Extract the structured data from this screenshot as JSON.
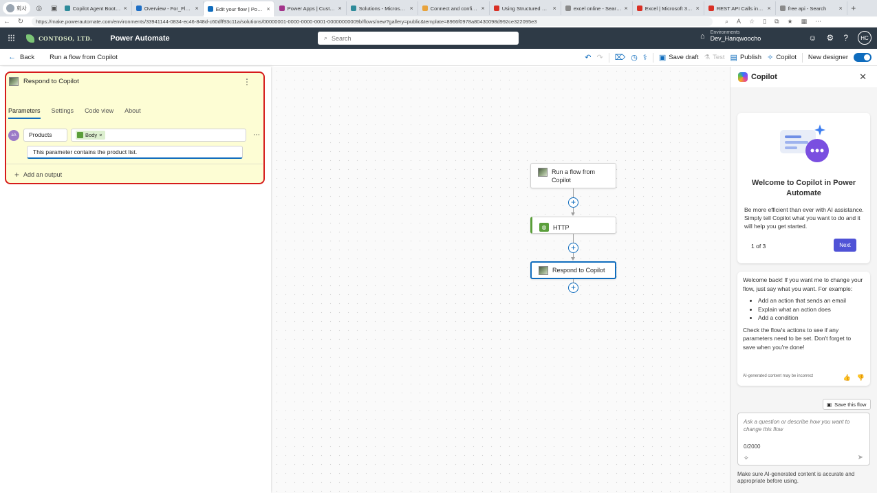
{
  "browser": {
    "profile": "회사",
    "tabs": [
      {
        "title": "Copilot Agent BootCamp",
        "color": "#2e8b9a",
        "active": false
      },
      {
        "title": "Overview - For_Flow | Mic",
        "color": "#1f6fc5",
        "active": false
      },
      {
        "title": "Edit your flow | Power Aut",
        "color": "#0f6cbd",
        "active": true
      },
      {
        "title": "Power Apps | Custom con",
        "color": "#a3338a",
        "active": false
      },
      {
        "title": "Solutions - Microsoft Cop",
        "color": "#2e8b9a",
        "active": false
      },
      {
        "title": "Connect and configure an",
        "color": "#e8a33c",
        "active": false
      },
      {
        "title": "Using Structured Data wit",
        "color": "#d93025",
        "active": false
      },
      {
        "title": "excel online - Search",
        "color": "#8a8a8a",
        "active": false
      },
      {
        "title": "Excel | Microsoft 365 Cop",
        "color": "#d93025",
        "active": false
      },
      {
        "title": "REST API Calls in Power A",
        "color": "#d93025",
        "active": false
      },
      {
        "title": "free api - Search",
        "color": "#8a8a8a",
        "active": false
      }
    ],
    "url": "https://make.powerautomate.com/environments/33941144-0834-ec46-848d-c60dff93c11a/solutions/00000001-0000-0000-0001-00000000009b/flows/new?gallery=public&template=8966f0978a80430098d992ce322095e3"
  },
  "header": {
    "org": "CONTOSO, LTD.",
    "app": "Power Automate",
    "search_placeholder": "Search",
    "env_label": "Environments",
    "env_name": "Dev_Hanqwoocho",
    "avatar": "HC"
  },
  "cmdbar": {
    "back": "Back",
    "flow_name": "Run a flow from Copilot",
    "save_draft": "Save draft",
    "test": "Test",
    "publish": "Publish",
    "copilot": "Copilot",
    "new_designer": "New designer"
  },
  "panel": {
    "title": "Respond to Copilot",
    "tabs": [
      "Parameters",
      "Settings",
      "Code view",
      "About"
    ],
    "param_avatar": "aA",
    "param_name": "Products",
    "token": "Body",
    "description": "This parameter contains the product list.",
    "add_output": "Add an output"
  },
  "canvas": {
    "nodes": [
      "Run a flow from Copilot",
      "HTTP",
      "Respond to Copilot"
    ]
  },
  "copilot": {
    "title": "Copilot",
    "welcome_title": "Welcome to Copilot in Power Automate",
    "welcome_body": "Be more efficient than ever with AI assistance. Simply tell Copilot what you want to do and it will help you get started.",
    "pager": "1 of 3",
    "next": "Next",
    "msg_intro": "Welcome back! If you want me to change your flow, just say what you want. For example:",
    "msg_items": [
      "Add an action that sends an email",
      "Explain what an action does",
      "Add a condition"
    ],
    "msg_outro": "Check the flow's actions to see if any parameters need to be set. Don't forget to save when you're done!",
    "ai_note": "AI-generated content may be incorrect",
    "save_flow": "Save this flow",
    "ask_placeholder": "Ask a question or describe how you want to change this flow",
    "char_count": "0/2000",
    "disclaimer": "Make sure AI-generated content is accurate and appropriate before using."
  }
}
